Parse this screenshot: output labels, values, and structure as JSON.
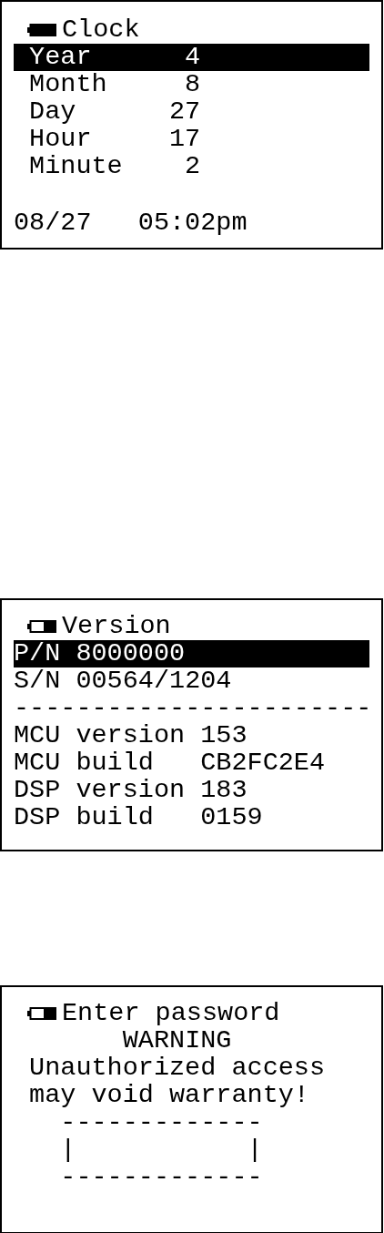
{
  "screens": [
    {
      "kind": "clock",
      "battery": {
        "kind": "full"
      },
      "title": "Clock",
      "rows": [
        {
          "label": "Year",
          "value": "4",
          "selected": true
        },
        {
          "label": "Month",
          "value": "8",
          "selected": false
        },
        {
          "label": "Day",
          "value": "27",
          "selected": false
        },
        {
          "label": "Hour",
          "value": "17",
          "selected": false
        },
        {
          "label": "Minute",
          "value": "2",
          "selected": false
        }
      ],
      "date": "08/27",
      "time": "05:02pm"
    },
    {
      "kind": "version",
      "battery": {
        "kind": "half"
      },
      "title": "Version",
      "lines": [
        {
          "kind": "text",
          "text": "P/N 8000000",
          "selected": true
        },
        {
          "kind": "text",
          "text": "S/N 00564/1204",
          "selected": false
        },
        {
          "kind": "separator",
          "text": "-----------------------"
        },
        {
          "kind": "field",
          "label": "MCU version",
          "value": "153",
          "selected": false
        },
        {
          "kind": "field",
          "label": "MCU build",
          "value": "CB2FC2E4",
          "selected": false
        },
        {
          "kind": "field",
          "label": "DSP version",
          "value": "183",
          "selected": false
        },
        {
          "kind": "field",
          "label": "DSP build",
          "value": "0159",
          "selected": false
        }
      ]
    },
    {
      "kind": "password",
      "battery": {
        "kind": "half"
      },
      "title": "Enter password",
      "heading": "WARNING",
      "message": [
        "Unauthorized access",
        "may void warranty!"
      ],
      "box": {
        "top": "-------------",
        "middle": "|           |",
        "bottom": "-------------"
      }
    }
  ]
}
